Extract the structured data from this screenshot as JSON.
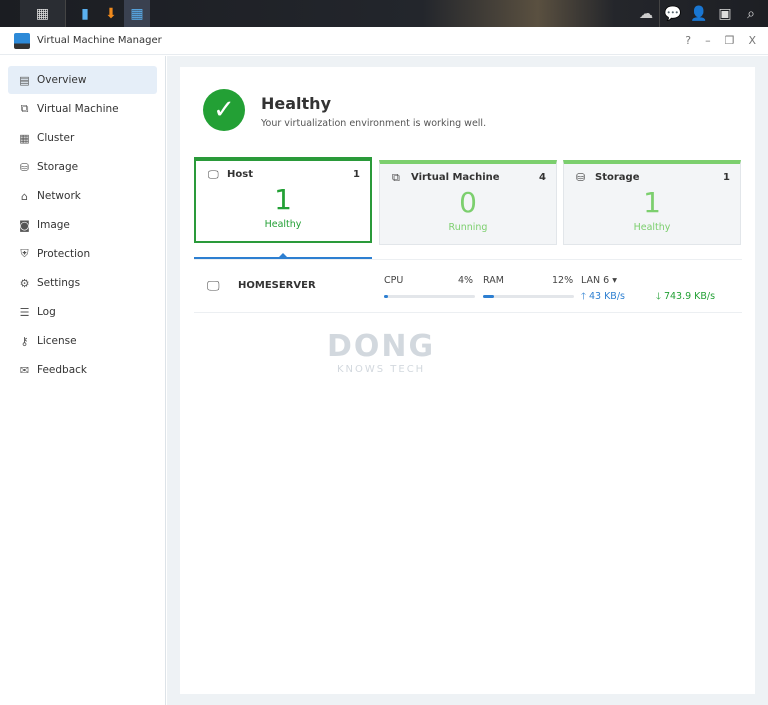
{
  "taskbar": {
    "left_icons": [
      "main-menu-icon",
      "app-icon-1",
      "download-icon",
      "vmm-icon"
    ],
    "right_icons": [
      "cloud-sync-icon",
      "notifications-icon",
      "user-icon",
      "widgets-icon",
      "search-icon"
    ]
  },
  "window": {
    "title": "Virtual Machine Manager",
    "controls": {
      "help": "?",
      "minimize": "–",
      "restore": "❐",
      "close": "X"
    }
  },
  "sidebar": {
    "items": [
      {
        "label": "Overview",
        "icon": "▤",
        "active": true
      },
      {
        "label": "Virtual Machine",
        "icon": "⧉"
      },
      {
        "label": "Cluster",
        "icon": "▦"
      },
      {
        "label": "Storage",
        "icon": "⛁"
      },
      {
        "label": "Network",
        "icon": "⌂"
      },
      {
        "label": "Image",
        "icon": "◙"
      },
      {
        "label": "Protection",
        "icon": "⛨"
      },
      {
        "label": "Settings",
        "icon": "⚙"
      },
      {
        "label": "Log",
        "icon": "☰"
      },
      {
        "label": "License",
        "icon": "⚷"
      },
      {
        "label": "Feedback",
        "icon": "✉"
      }
    ]
  },
  "status": {
    "title": "Healthy",
    "subtitle": "Your virtualization environment is working well.",
    "icon": "✓"
  },
  "cards": [
    {
      "label": "Host",
      "count": "1",
      "value": "1",
      "state": "Healthy",
      "icon": "🖵"
    },
    {
      "label": "Virtual Machine",
      "count": "4",
      "value": "0",
      "state": "Running",
      "icon": "⧉"
    },
    {
      "label": "Storage",
      "count": "1",
      "value": "1",
      "state": "Healthy",
      "icon": "⛁"
    }
  ],
  "host": {
    "name": "HOMESERVER",
    "cpu_label": "CPU",
    "cpu": "4%",
    "cpu_fraction": 0.04,
    "ram_label": "RAM",
    "ram": "12%",
    "ram_fraction": 0.12,
    "lan": "LAN 6 ▾",
    "upload": "🡑 43 KB/s",
    "download": "🡓 743.9 KB/s"
  },
  "watermark": {
    "line1": "DONG",
    "line2": "KNOWS TECH"
  },
  "colors": {
    "healthy": "#23a035",
    "accent": "#2d7fd1"
  }
}
